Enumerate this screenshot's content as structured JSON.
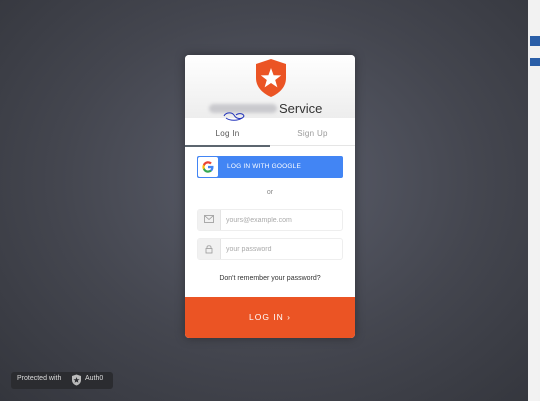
{
  "brand": {
    "service_name": "Service",
    "accent_color": "#eb5424",
    "logo_icon": "auth0-shield-star-icon"
  },
  "tabs": {
    "login": "Log In",
    "signup": "Sign Up"
  },
  "social": {
    "google_label": "LOG IN WITH GOOGLE",
    "google_color": "#4285f4"
  },
  "divider": "or",
  "fields": {
    "email_placeholder": "yours@example.com",
    "password_placeholder": "your password",
    "email_icon": "envelope-icon",
    "password_icon": "lock-icon"
  },
  "forgot_link": "Don't remember your password?",
  "submit": {
    "label": "LOG IN",
    "arrow": "›"
  },
  "footer": {
    "protected_text": "Protected with",
    "brand": "Auth0"
  }
}
